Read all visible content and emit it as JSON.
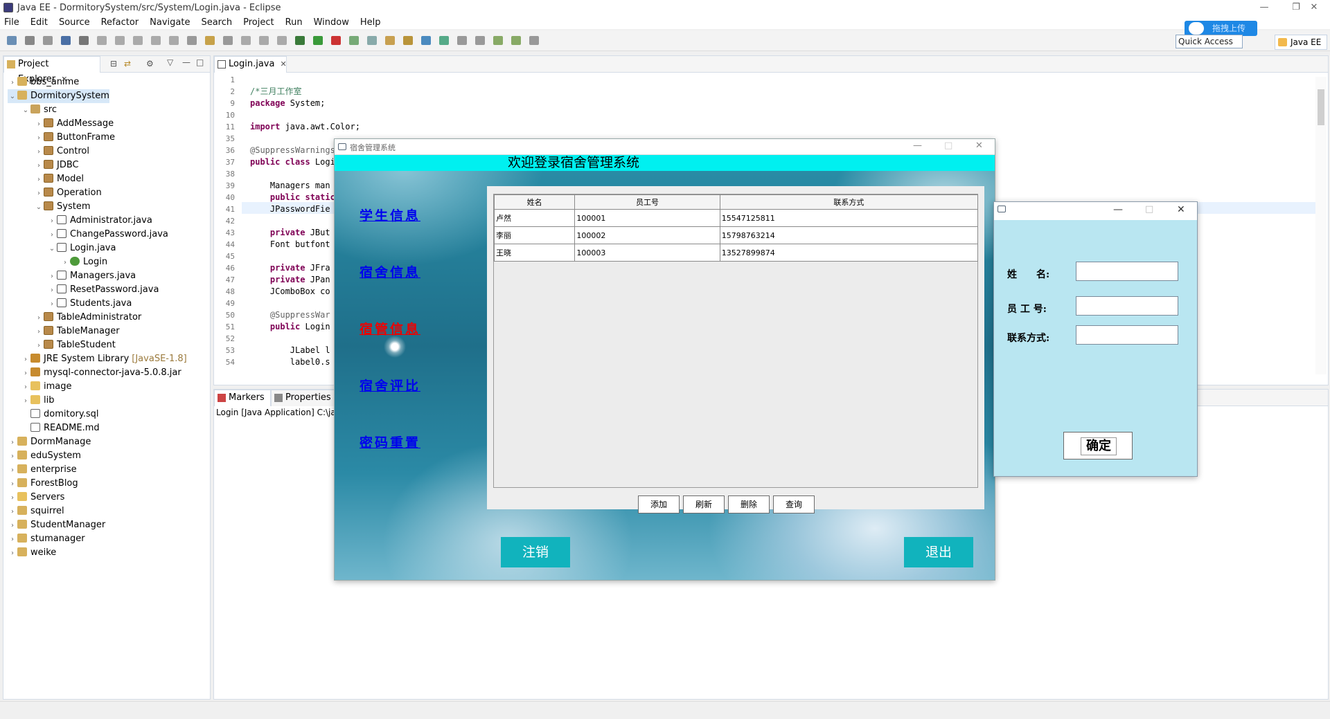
{
  "window": {
    "title": "Java EE - DormitorySystem/src/System/Login.java - Eclipse"
  },
  "menu": [
    "File",
    "Edit",
    "Source",
    "Refactor",
    "Navigate",
    "Search",
    "Project",
    "Run",
    "Window",
    "Help"
  ],
  "quick_access": "Quick Access",
  "upload_label": "拖拽上传",
  "perspective": "Java EE",
  "explorer": {
    "tab": "Project Explorer",
    "items": [
      {
        "label": "bbs_anime",
        "indent": 0,
        "arrow": ">",
        "icon": "proj"
      },
      {
        "label": "DormitorySystem",
        "indent": 0,
        "arrow": "v",
        "icon": "proj",
        "selected": true
      },
      {
        "label": "src",
        "indent": 1,
        "arrow": "v",
        "icon": "src"
      },
      {
        "label": "AddMessage",
        "indent": 2,
        "arrow": ">",
        "icon": "pkg"
      },
      {
        "label": "ButtonFrame",
        "indent": 2,
        "arrow": ">",
        "icon": "pkg"
      },
      {
        "label": "Control",
        "indent": 2,
        "arrow": ">",
        "icon": "pkg"
      },
      {
        "label": "JDBC",
        "indent": 2,
        "arrow": ">",
        "icon": "pkg"
      },
      {
        "label": "Model",
        "indent": 2,
        "arrow": ">",
        "icon": "pkg"
      },
      {
        "label": "Operation",
        "indent": 2,
        "arrow": ">",
        "icon": "pkg"
      },
      {
        "label": "System",
        "indent": 2,
        "arrow": "v",
        "icon": "pkg"
      },
      {
        "label": "Administrator.java",
        "indent": 3,
        "arrow": ">",
        "icon": "java"
      },
      {
        "label": "ChangePassword.java",
        "indent": 3,
        "arrow": ">",
        "icon": "java"
      },
      {
        "label": "Login.java",
        "indent": 3,
        "arrow": "v",
        "icon": "java"
      },
      {
        "label": "Login",
        "indent": 4,
        "arrow": ">",
        "icon": "cls"
      },
      {
        "label": "Managers.java",
        "indent": 3,
        "arrow": ">",
        "icon": "java"
      },
      {
        "label": "ResetPassword.java",
        "indent": 3,
        "arrow": ">",
        "icon": "java"
      },
      {
        "label": "Students.java",
        "indent": 3,
        "arrow": ">",
        "icon": "java"
      },
      {
        "label": "TableAdministrator",
        "indent": 2,
        "arrow": ">",
        "icon": "pkg"
      },
      {
        "label": "TableManager",
        "indent": 2,
        "arrow": ">",
        "icon": "pkg"
      },
      {
        "label": "TableStudent",
        "indent": 2,
        "arrow": ">",
        "icon": "pkg"
      },
      {
        "label": "JRE System Library",
        "deco": "[JavaSE-1.8]",
        "indent": 1,
        "arrow": ">",
        "icon": "jar"
      },
      {
        "label": "mysql-connector-java-5.0.8.jar",
        "indent": 1,
        "arrow": ">",
        "icon": "jar"
      },
      {
        "label": "image",
        "indent": 1,
        "arrow": ">",
        "icon": "fold"
      },
      {
        "label": "lib",
        "indent": 1,
        "arrow": ">",
        "icon": "fold"
      },
      {
        "label": "domitory.sql",
        "indent": 1,
        "arrow": "",
        "icon": "file"
      },
      {
        "label": "README.md",
        "indent": 1,
        "arrow": "",
        "icon": "file"
      },
      {
        "label": "DormManage",
        "indent": 0,
        "arrow": ">",
        "icon": "proj"
      },
      {
        "label": "eduSystem",
        "indent": 0,
        "arrow": ">",
        "icon": "proj"
      },
      {
        "label": "enterprise",
        "indent": 0,
        "arrow": ">",
        "icon": "proj"
      },
      {
        "label": "ForestBlog",
        "indent": 0,
        "arrow": ">",
        "icon": "proj"
      },
      {
        "label": "Servers",
        "indent": 0,
        "arrow": ">",
        "icon": "fold"
      },
      {
        "label": "squirrel",
        "indent": 0,
        "arrow": ">",
        "icon": "proj"
      },
      {
        "label": "StudentManager",
        "indent": 0,
        "arrow": ">",
        "icon": "proj"
      },
      {
        "label": "stumanager",
        "indent": 0,
        "arrow": ">",
        "icon": "proj"
      },
      {
        "label": "weike",
        "indent": 0,
        "arrow": ">",
        "icon": "proj"
      }
    ]
  },
  "editor": {
    "tab": "Login.java",
    "lines": [
      {
        "n": "1",
        "t": ""
      },
      {
        "n": "2",
        "t": "/*三月工作室",
        "cls": "cm"
      },
      {
        "n": "9",
        "t": "package System;",
        "kw": "package"
      },
      {
        "n": "10",
        "t": ""
      },
      {
        "n": "11",
        "t": "import java.awt.Color;",
        "kw": "import"
      },
      {
        "n": "35",
        "t": ""
      },
      {
        "n": "36",
        "t": "@SuppressWarnings(",
        "cls": "an"
      },
      {
        "n": "37",
        "t": "public class Login",
        "kw": "public class"
      },
      {
        "n": "38",
        "t": ""
      },
      {
        "n": "39",
        "t": "    Managers man"
      },
      {
        "n": "40",
        "t": "    public static",
        "kw": "public static"
      },
      {
        "n": "41",
        "t": "    JPasswordFie"
      },
      {
        "n": "42",
        "t": ""
      },
      {
        "n": "43",
        "t": "    private JBut",
        "kw": "private"
      },
      {
        "n": "44",
        "t": "    Font butfont"
      },
      {
        "n": "45",
        "t": ""
      },
      {
        "n": "46",
        "t": "    private JFra",
        "kw": "private"
      },
      {
        "n": "47",
        "t": "    private JPan",
        "kw": "private"
      },
      {
        "n": "48",
        "t": "    JComboBox co"
      },
      {
        "n": "49",
        "t": ""
      },
      {
        "n": "50",
        "t": "    @SuppressWar",
        "cls": "an"
      },
      {
        "n": "51",
        "t": "    public Login",
        "kw": "public"
      },
      {
        "n": "52",
        "t": ""
      },
      {
        "n": "53",
        "t": "        JLabel l"
      },
      {
        "n": "54",
        "t": "        label0.s"
      }
    ]
  },
  "console": {
    "tabs": [
      "Markers",
      "Properties"
    ],
    "text": "Login [Java Application] C:\\jav"
  },
  "swing": {
    "title": "宿舍管理系统",
    "welcome": "欢迎登录宿舍管理系统",
    "nav": [
      {
        "label": "学生信息",
        "color": "#0000ee"
      },
      {
        "label": "宿舍信息",
        "color": "#0000ee"
      },
      {
        "label": "宿管信息",
        "color": "#ee0000"
      },
      {
        "label": "宿舍评比",
        "color": "#0000ee"
      },
      {
        "label": "密码重置",
        "color": "#0000ee"
      }
    ],
    "table": {
      "headers": [
        "姓名",
        "员工号",
        "联系方式"
      ],
      "rows": [
        [
          "卢然",
          "100001",
          "15547125811"
        ],
        [
          "李丽",
          "100002",
          "15798763214"
        ],
        [
          "王晓",
          "100003",
          "13527899874"
        ]
      ]
    },
    "buttons": [
      "添加",
      "刷新",
      "删除",
      "查询"
    ],
    "logout": "注销",
    "exit": "退出"
  },
  "dialog": {
    "labels": [
      "姓　　名:",
      "员 工 号:",
      "联系方式:"
    ],
    "ok": "确定"
  }
}
